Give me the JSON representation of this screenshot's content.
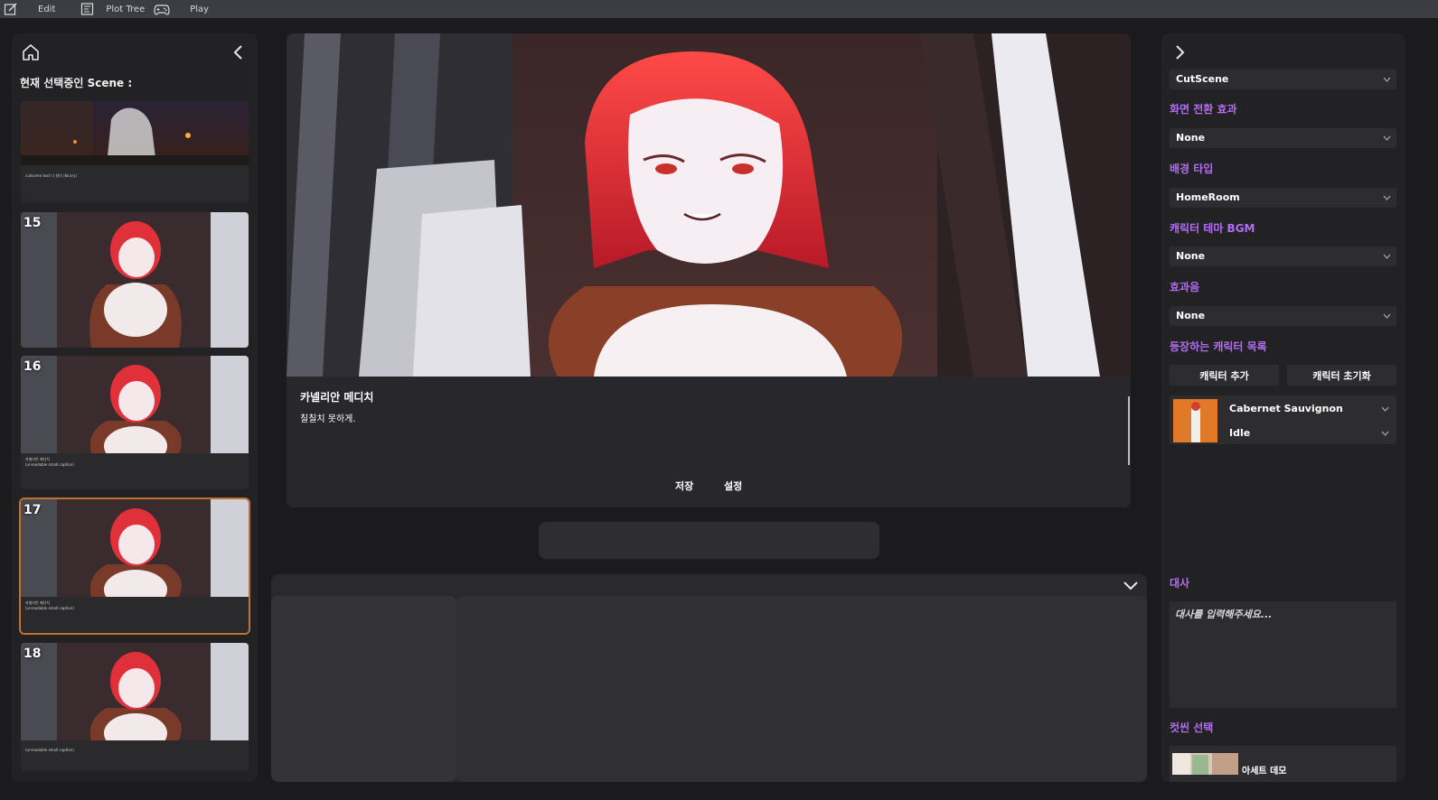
{
  "menubar": {
    "items": [
      {
        "label": "Edit",
        "icon": "edit-note-icon"
      },
      {
        "label": "Plot Tree",
        "icon": "plot-tree-icon"
      },
      {
        "label": "Play",
        "icon": "gamepad-icon"
      }
    ]
  },
  "scene_list": {
    "current_label": "현재 선택중인 Scene :",
    "scenes": [
      {
        "number": "",
        "caption": "cutscene text 나 왔다 (blurry)",
        "kind": "night-street"
      },
      {
        "number": "15",
        "caption": "",
        "kind": "character"
      },
      {
        "number": "16",
        "caption": "카넬리안 메디치\n(unreadable small caption)",
        "kind": "character"
      },
      {
        "number": "17",
        "caption": "카넬리안 메디치\n(unreadable small caption)",
        "kind": "character",
        "selected": true
      },
      {
        "number": "18",
        "caption": "(unreadable small caption)",
        "kind": "character"
      }
    ]
  },
  "preview": {
    "speaker": "카넬리안 메디치",
    "line": "칠칠치 못하게.",
    "save_label": "저장",
    "settings_label": "설정"
  },
  "inspector": {
    "scene_type": "CutScene",
    "transition_label": "화면 전환 효과",
    "transition_value": "None",
    "background_label": "배경 타입",
    "background_value": "HomeRoom",
    "bgm_label": "캐릭터 테마 BGM",
    "bgm_value": "None",
    "sfx_label": "효과음",
    "sfx_value": "None",
    "characters_label": "등장하는 캐릭터 목록",
    "add_character_label": "캐릭터 추가",
    "reset_character_label": "캐릭터 초기화",
    "character": {
      "name": "Cabernet Sauvignon",
      "state": "Idle"
    },
    "dialog_label": "대사",
    "dialog_placeholder": "대사를 입력해주세요...",
    "cutscene_label": "컷씬 선택",
    "cutscene_name": "아세트 데모"
  },
  "colors": {
    "accent_purple": "#b26df0",
    "selected_border": "#c07030",
    "panel": "#222225",
    "background": "#1b1b1d"
  }
}
